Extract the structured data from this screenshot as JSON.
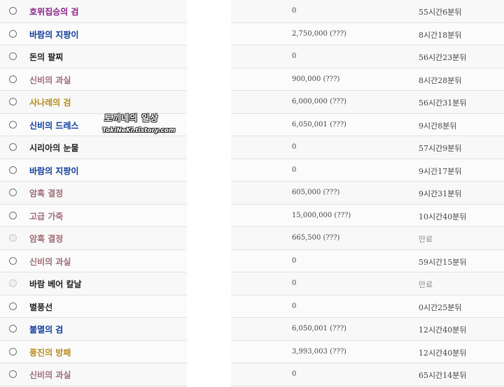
{
  "rows": [
    {
      "name": "호위집승의 검",
      "price": "0",
      "time": "55시간6분뒤",
      "color": "#8b1a8b",
      "enabled": true
    },
    {
      "name": "바람의 지팡이",
      "price": "2,750,000 (???)",
      "time": "8시간18분뒤",
      "color": "#0c3b9a",
      "enabled": true
    },
    {
      "name": "돈의 팔찌",
      "price": "0",
      "time": "56시간23분뒤",
      "color": "#222222",
      "enabled": true
    },
    {
      "name": "신비의 과실",
      "price": "900,000 (???)",
      "time": "8시간28분뒤",
      "color": "#a06a76",
      "enabled": true
    },
    {
      "name": "사나레의 검",
      "price": "6,000,000 (???)",
      "time": "56시간31분뒤",
      "color": "#b88a1c",
      "enabled": true
    },
    {
      "name": "신비의 드레스",
      "price": "6,050,001 (???)",
      "time": "9시간8분뒤",
      "color": "#0c3b9a",
      "enabled": true
    },
    {
      "name": "시리아의 눈물",
      "price": "0",
      "time": "57시간9분뒤",
      "color": "#222222",
      "enabled": true
    },
    {
      "name": "바람의 지팡이",
      "price": "0",
      "time": "9시간17분뒤",
      "color": "#0c3b9a",
      "enabled": true
    },
    {
      "name": "암흑 결정",
      "price": "605,000 (???)",
      "time": "9시간31분뒤",
      "color": "#a06a76",
      "enabled": true
    },
    {
      "name": "고급 가죽",
      "price": "15,000,000 (???)",
      "time": "10시간40분뒤",
      "color": "#a06a76",
      "enabled": true
    },
    {
      "name": "암흑 결정",
      "price": "665,500 (???)",
      "time": "만료",
      "color": "#a06a76",
      "enabled": false
    },
    {
      "name": "신비의 과실",
      "price": "0",
      "time": "59시간15분뒤",
      "color": "#a06a76",
      "enabled": true
    },
    {
      "name": "바람 베어 칼날",
      "price": "0",
      "time": "만료",
      "color": "#222222",
      "enabled": false
    },
    {
      "name": "별풍선",
      "price": "0",
      "time": "0시간25분뒤",
      "color": "#222222",
      "enabled": true
    },
    {
      "name": "불멸의 검",
      "price": "6,050,001 (???)",
      "time": "12시간40분뒤",
      "color": "#0c3b9a",
      "enabled": true
    },
    {
      "name": "풍진의 방패",
      "price": "3,993,003 (???)",
      "time": "12시간40분뒤",
      "color": "#b88a1c",
      "enabled": true
    },
    {
      "name": "신비의 과실",
      "price": "0",
      "time": "65시간14분뒤",
      "color": "#a06a76",
      "enabled": true
    }
  ],
  "watermark": {
    "korean": "토끼네의 일상",
    "english": "TokiNeKi.tistory.com"
  }
}
